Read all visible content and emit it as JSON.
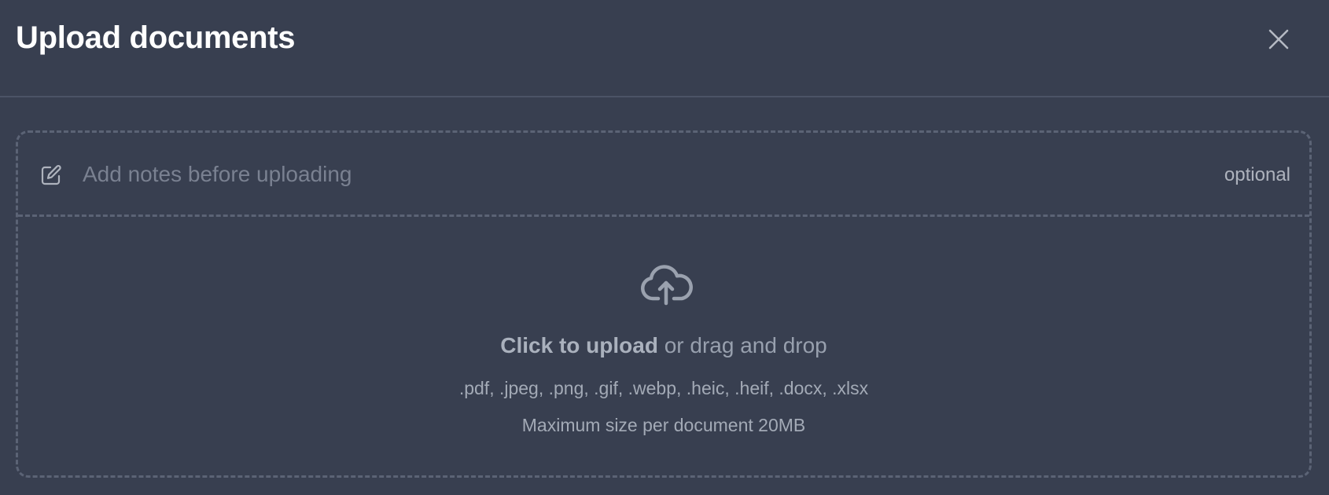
{
  "modal": {
    "title": "Upload documents",
    "close_icon": "close-icon"
  },
  "notes": {
    "icon": "edit-icon",
    "placeholder": "Add notes before uploading",
    "value": "",
    "optional_label": "optional"
  },
  "upload": {
    "icon": "cloud-upload-icon",
    "click_text": "Click to upload",
    "drag_text": " or drag and drop",
    "file_types": ".pdf, .jpeg, .png, .gif, .webp, .heic, .heif, .docx, .xlsx",
    "max_size": "Maximum size per document 20MB"
  },
  "colors": {
    "background": "#383f50",
    "title": "#ffffff",
    "border": "#5b6375",
    "muted_text": "#a3aab6",
    "placeholder": "#7a8191"
  }
}
